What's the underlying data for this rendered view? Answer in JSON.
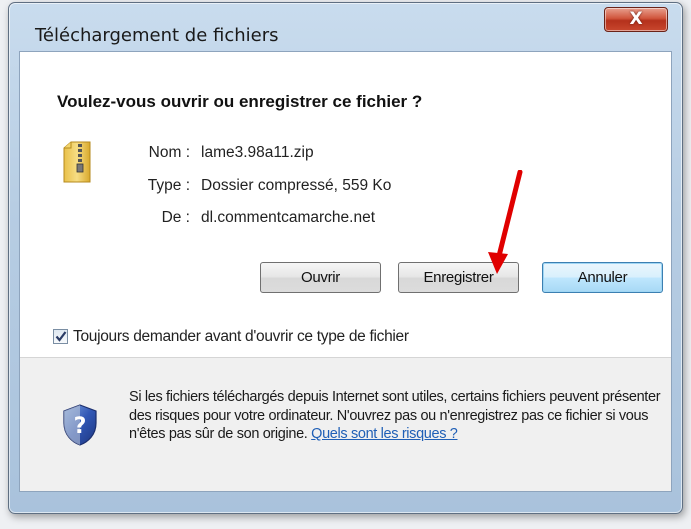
{
  "window": {
    "title": "Téléchargement de fichiers",
    "close_label": "X"
  },
  "dialog": {
    "question": "Voulez-vous ouvrir ou enregistrer ce fichier ?",
    "file_icon": "zip-folder-icon",
    "fields": {
      "name_label": "Nom :",
      "name_value": "lame3.98a11.zip",
      "type_label": "Type :",
      "type_value": "Dossier compressé, 559 Ko",
      "from_label": "De :",
      "from_value": "dl.commentcamarche.net"
    },
    "buttons": {
      "open": "Ouvrir",
      "save": "Enregistrer",
      "cancel": "Annuler"
    },
    "checkbox": {
      "label": "Toujours demander avant d'ouvrir ce type de fichier",
      "checked": true
    }
  },
  "warning": {
    "icon": "shield-question-icon",
    "text": "Si les fichiers téléchargés depuis Internet sont utiles, certains fichiers peuvent présenter des risques pour votre ordinateur. N'ouvrez pas ou n'enregistrez pas ce fichier si vous n'êtes pas sûr de son origine. ",
    "link_text": "Quels sont les risques ?"
  },
  "annotation": {
    "arrow_color": "#e00000"
  },
  "colors": {
    "link": "#1f5fb6",
    "default_button_border": "#3c7fb1",
    "close_button": "#c8472e"
  }
}
